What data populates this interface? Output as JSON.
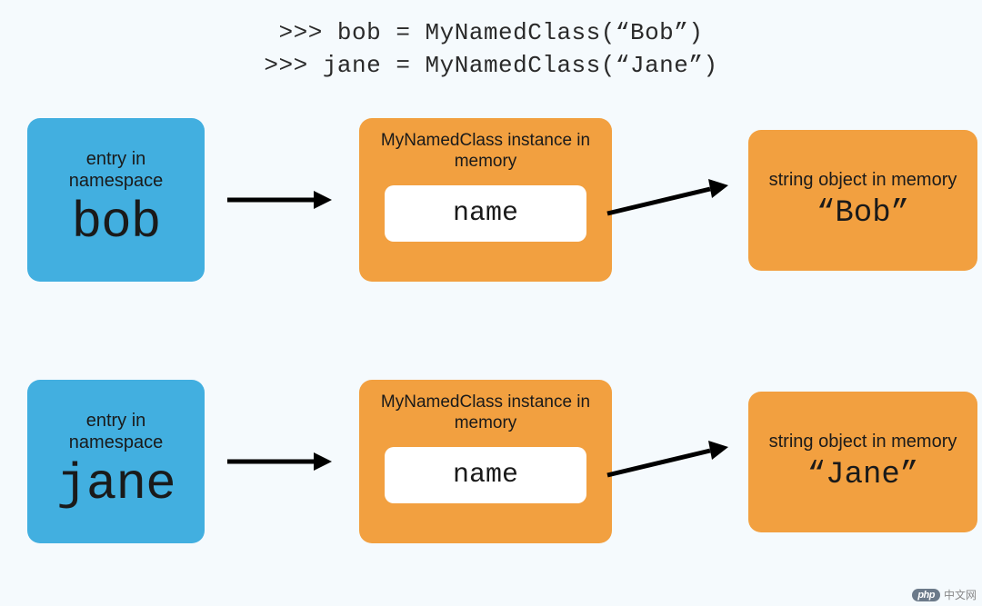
{
  "code": {
    "line1": ">>> bob = MyNamedClass(“Bob”)",
    "line2": ">>> jane = MyNamedClass(“Jane”)"
  },
  "rows": {
    "r1": {
      "namespace_label": "entry in namespace",
      "var": "bob",
      "instance_label": "MyNamedClass instance in memory",
      "attr": "name",
      "string_label": "string object in memory",
      "value": "“Bob”"
    },
    "r2": {
      "namespace_label": "entry in namespace",
      "var": "jane",
      "instance_label": "MyNamedClass instance in memory",
      "attr": "name",
      "string_label": "string object in memory",
      "value": "“Jane”"
    }
  },
  "watermark": {
    "badge": "php",
    "text": "中文网"
  },
  "chart_data": {
    "type": "diagram",
    "description": "Object reference diagram showing two class instantiations",
    "nodes": [
      {
        "id": "bob_ns",
        "kind": "namespace-entry",
        "name": "bob"
      },
      {
        "id": "bob_inst",
        "kind": "class-instance",
        "class": "MyNamedClass",
        "attrs": [
          "name"
        ]
      },
      {
        "id": "bob_str",
        "kind": "string-object",
        "value": "Bob"
      },
      {
        "id": "jane_ns",
        "kind": "namespace-entry",
        "name": "jane"
      },
      {
        "id": "jane_inst",
        "kind": "class-instance",
        "class": "MyNamedClass",
        "attrs": [
          "name"
        ]
      },
      {
        "id": "jane_str",
        "kind": "string-object",
        "value": "Jane"
      }
    ],
    "edges": [
      {
        "from": "bob_ns",
        "to": "bob_inst"
      },
      {
        "from": "bob_inst",
        "to": "bob_str",
        "via": "name"
      },
      {
        "from": "jane_ns",
        "to": "jane_inst"
      },
      {
        "from": "jane_inst",
        "to": "jane_str",
        "via": "name"
      }
    ]
  }
}
